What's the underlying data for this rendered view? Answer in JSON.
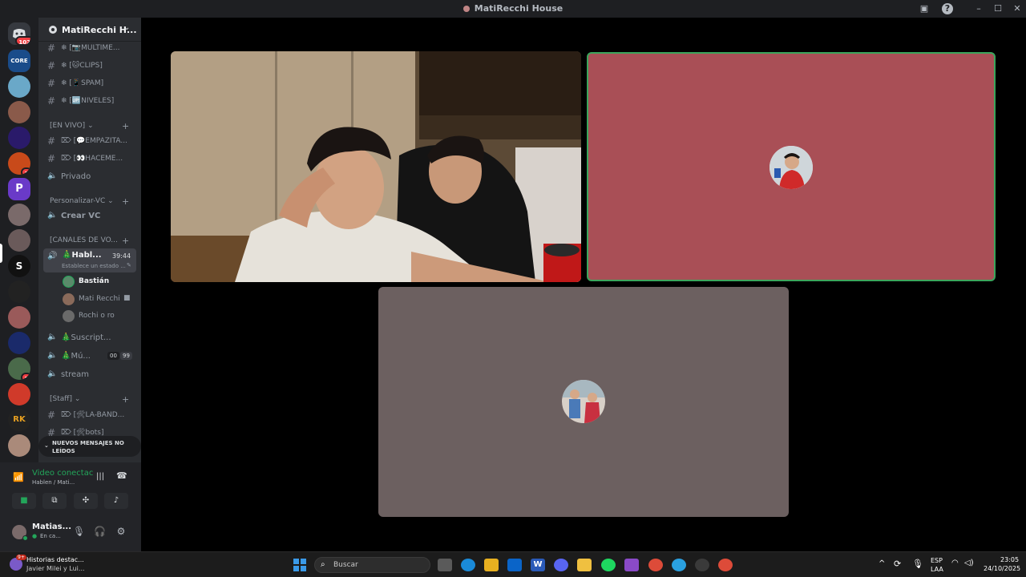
{
  "window": {
    "title": "MatiRecchi House",
    "icons": {
      "inbox": "inbox-icon",
      "help": "help-icon",
      "minimize": "minimize-icon",
      "maximize": "maximize-icon",
      "close": "close-icon"
    }
  },
  "server_rail": {
    "home_badge": "102",
    "server_badges": [
      "1",
      "2"
    ]
  },
  "guild": {
    "name": "MatiRecchi H...",
    "channels": [
      {
        "label": "❄ [📷MULTIME..."
      },
      {
        "label": "❄ [🐱CLIPS]"
      },
      {
        "label": "❄ [📱SPAM]"
      },
      {
        "label": "❄ [🆙NIVELES]"
      }
    ],
    "cat_envivo": "[EN VIVO]",
    "envivo_channels": [
      {
        "label": "⌦ [💬EMPAZITA..."
      },
      {
        "label": "⌦ [👀HACEME..."
      }
    ],
    "privado": "Privado",
    "cat_personalizar": "Personalizar-VC",
    "crear_vc": "Crear VC",
    "cat_canales": "[CANALES DE VO...",
    "active_vc": {
      "name": "🎄Habl...",
      "time": "39:44",
      "status": "Establece un estado ..."
    },
    "vc_users": [
      "Bastián",
      "Mati Recchi",
      "Rochi o ro"
    ],
    "vc_suscript": "🎄Suscript...",
    "vc_mu": {
      "name": "🎄Mú...",
      "c1": "00",
      "c2": "99"
    },
    "stream": "stream",
    "cat_staff": "[Staff]",
    "staff_channels": [
      {
        "label": "⌦ [🛠LA-BAND..."
      },
      {
        "label": "⌦ [🛠bots]"
      }
    ]
  },
  "unread": "NUEVOS MENSAJES NO LEÍDOS",
  "voice_panel": {
    "status": "Video conectac",
    "sub": "Hablen / Mati...",
    "user": "Matias...",
    "user_status": "En ca..."
  },
  "taskbar": {
    "notif_title": "Historias destac...",
    "notif_sub": "Javier Milei y Lui...",
    "search": "Buscar",
    "lang1": "ESP",
    "lang2": "LAA",
    "time": "23:05",
    "date": "24/10/2025"
  },
  "colors": {
    "accent_green": "#23a55a",
    "tile_red": "#a94f56",
    "tile_gray": "#6c6060"
  }
}
